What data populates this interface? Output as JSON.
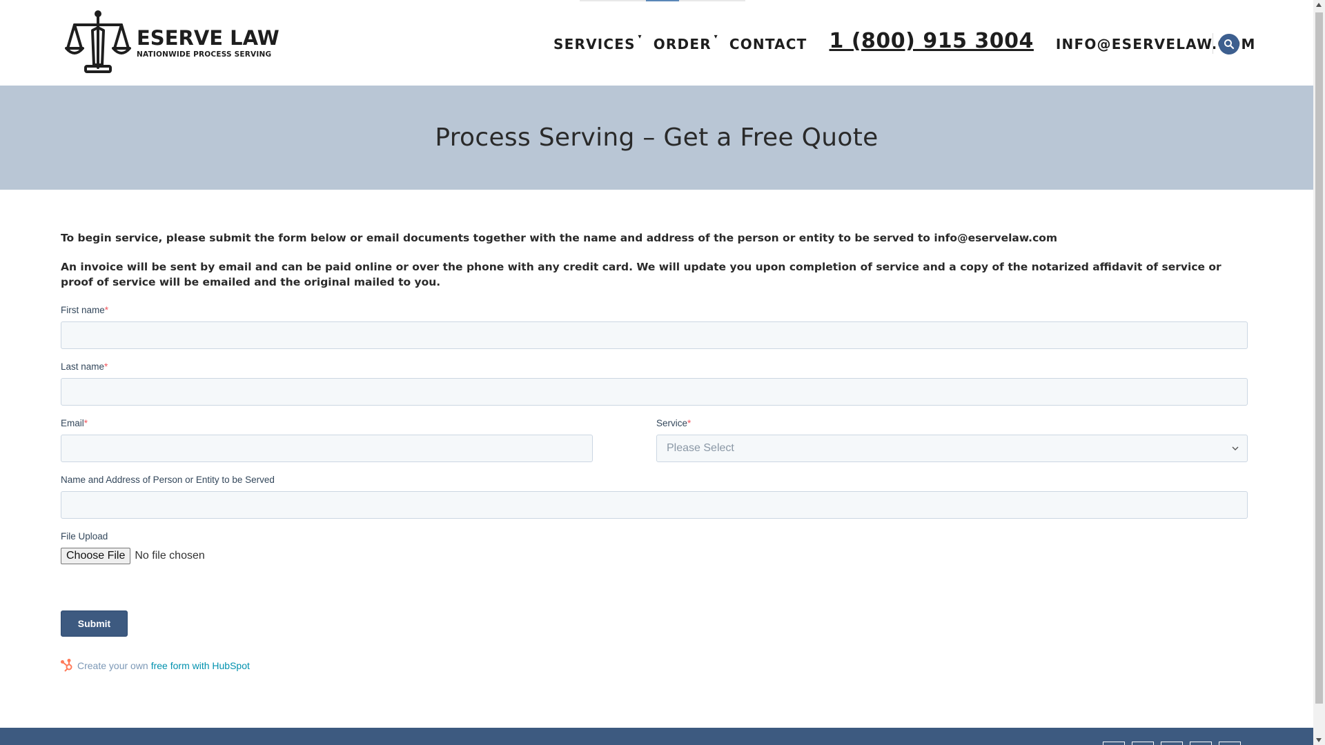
{
  "header": {
    "logo_title": "ESERVE LAW",
    "logo_subtitle": "NATIONWIDE PROCESS SERVING",
    "nav": {
      "services": "SERVICES",
      "order": "ORDER",
      "contact": "CONTACT",
      "phone": "1 (800) 915 3004",
      "email": "INFO@ESERVELAW.COM"
    }
  },
  "hero": {
    "title": "Process Serving – Get a Free Quote"
  },
  "intro": {
    "paragraph_1": "To begin service, please submit the form below or email documents together with the name and address of the person or entity to be served to info@eservelaw.com",
    "paragraph_2": "An invoice will be sent by email and can be paid online or over the phone with any credit card. We will update you upon completion of service and a copy of the notarized affidavit of service or proof of service will be emailed and the original mailed to you."
  },
  "form": {
    "first_name_label": "First name",
    "last_name_label": "Last name",
    "email_label": "Email",
    "service_label": "Service",
    "service_value": "Please Select",
    "served_party_label": "Name and Address of Person or Entity to be Served",
    "file_upload_label": "File Upload",
    "file_button": "Choose File",
    "file_status": "No file chosen",
    "required_marker": "*",
    "submit_label": "Submit"
  },
  "hubspot": {
    "prefix": "Create your own",
    "link": "free form with HubSpot"
  },
  "colors": {
    "hero_bg": "#b9c6d5",
    "accent_blue": "#3d5a80",
    "input_bg": "#f5f8fa",
    "input_border": "#cbd6e2",
    "required_red": "#f2545b",
    "link_teal": "#0091ae"
  },
  "icons": {
    "logo": "scales-of-justice-icon",
    "search": "search-icon",
    "hubspot": "hubspot-sprocket-icon"
  }
}
